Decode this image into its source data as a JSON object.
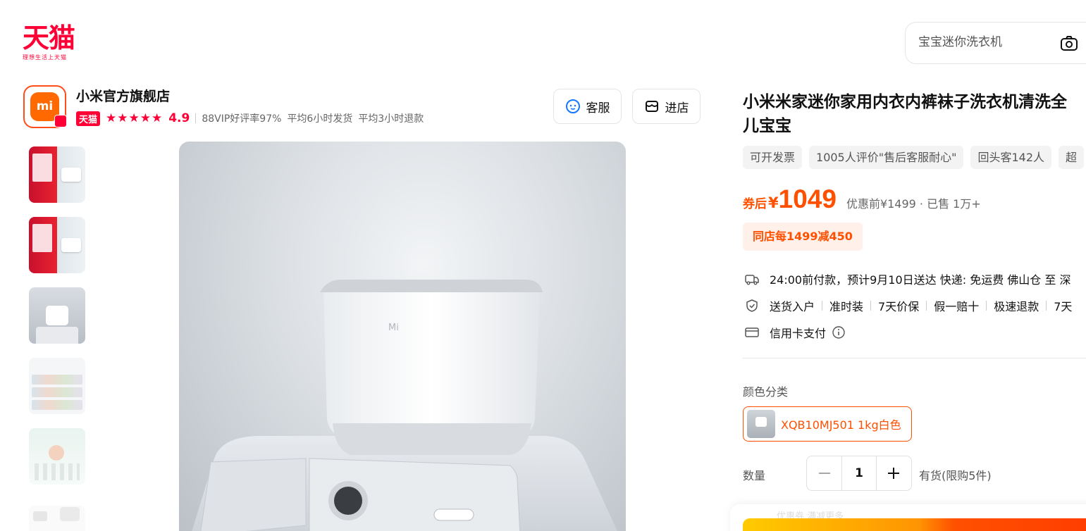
{
  "brand": {
    "logo_text": "天猫",
    "logo_sub": "理想生活上天猫",
    "color": "#ff0036"
  },
  "search": {
    "placeholder": "宝宝迷你洗衣机",
    "icon": "camera-icon"
  },
  "shop": {
    "logo_text": "mi",
    "name": "小米官方旗舰店",
    "badge": "天猫",
    "stars": "★★★★★",
    "rating": "4.9",
    "vip_rate": "88VIP好评率97%",
    "ship_time": "平均6小时发货",
    "refund_time": "平均3小时退款",
    "service_button": "客服",
    "enter_button": "进店"
  },
  "gallery": {
    "thumbnails": [
      {
        "alt": "promo-image-1"
      },
      {
        "alt": "promo-image-2"
      },
      {
        "alt": "mini-washer-on-machine"
      },
      {
        "alt": "usage-scenes"
      },
      {
        "alt": "baby-care-features"
      },
      {
        "alt": "product-details"
      }
    ],
    "main_image": "mijia-mini-washer-hero"
  },
  "product": {
    "title_line1": "小米米家迷你家用内衣内裤袜子洗衣机清洗全",
    "title_line2": "儿宝宝",
    "tags": [
      "可开发票",
      "1005人评价\"售后客服耐心\"",
      "回头客142人",
      "超"
    ],
    "price_prefix": "券后",
    "currency": "¥",
    "price": "1049",
    "original_price": "优惠前¥1499 · 已售 1万+",
    "promo": "同店每1499减450",
    "delivery": "24:00前付款，预计9月10日送达  快递: 免运费  佛山仓 至 深",
    "services": [
      "送货入户",
      "准时装",
      "7天价保",
      "假一赔十",
      "极速退款",
      "7天"
    ],
    "payment": "信用卡支付",
    "color_label": "颜色分类",
    "sku_name": "XQB10MJ501 1kg白色",
    "quantity_label": "数量",
    "quantity": "1",
    "stock": "有货(限购5件)",
    "bottom_faded": "优惠券  满减更多",
    "accent_color": "#ff5000"
  }
}
